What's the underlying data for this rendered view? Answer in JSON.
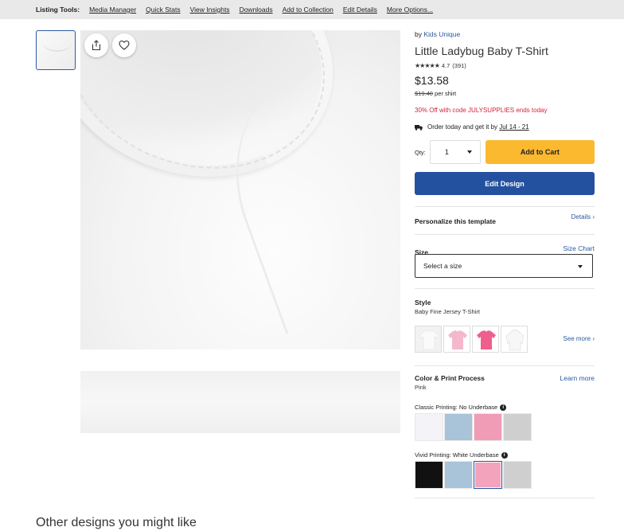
{
  "tools": {
    "label": "Listing Tools:",
    "links": [
      "Media Manager",
      "Quick Stats",
      "View Insights",
      "Downloads",
      "Add to Collection",
      "Edit Details",
      "More Options..."
    ]
  },
  "product": {
    "by_prefix": "by",
    "store": "Kids Unique",
    "title": "Little Ladybug Baby T-Shirt",
    "stars": "★★★★★",
    "rating": "4.7",
    "reviews": "(391)",
    "price": "$13.58",
    "old_price": "$19.40",
    "per_unit": "per shirt",
    "promo": "30% Off with code JULYSUPPLIES ends today",
    "delivery_text": "Order today and get it by",
    "delivery_date": "Jul 14 - 21"
  },
  "purchase": {
    "qty_label": "Qty:",
    "qty_value": "1",
    "add_to_cart": "Add to Cart",
    "edit_design": "Edit Design"
  },
  "personalize": {
    "title": "Personalize this template",
    "details_link": "Details ›"
  },
  "size": {
    "title": "Size",
    "chart_link": "Size Chart",
    "select_placeholder": "Select a size"
  },
  "style": {
    "title": "Style",
    "selected": "Baby Fine Jersey T-Shirt",
    "see_more": "See more ›",
    "swatch_colors": [
      "#f2f2f2",
      "#f4b8cc",
      "#ef5f8e",
      "#f7f7f7"
    ]
  },
  "color": {
    "title": "Color & Print Process",
    "learn_more": "Learn more",
    "selected": "Pink",
    "classic_label": "Classic Printing: No Underbase",
    "classic_swatches": [
      "#f4f3f8",
      "#a9c3d8",
      "#f09cb6",
      "#cfcfcf"
    ],
    "vivid_label": "Vivid Printing: White Underbase",
    "vivid_swatches": [
      "#111111",
      "#a9c3d8",
      "#f4a3bc",
      "#cfcfcf"
    ]
  },
  "other_designs": "Other designs you might like"
}
